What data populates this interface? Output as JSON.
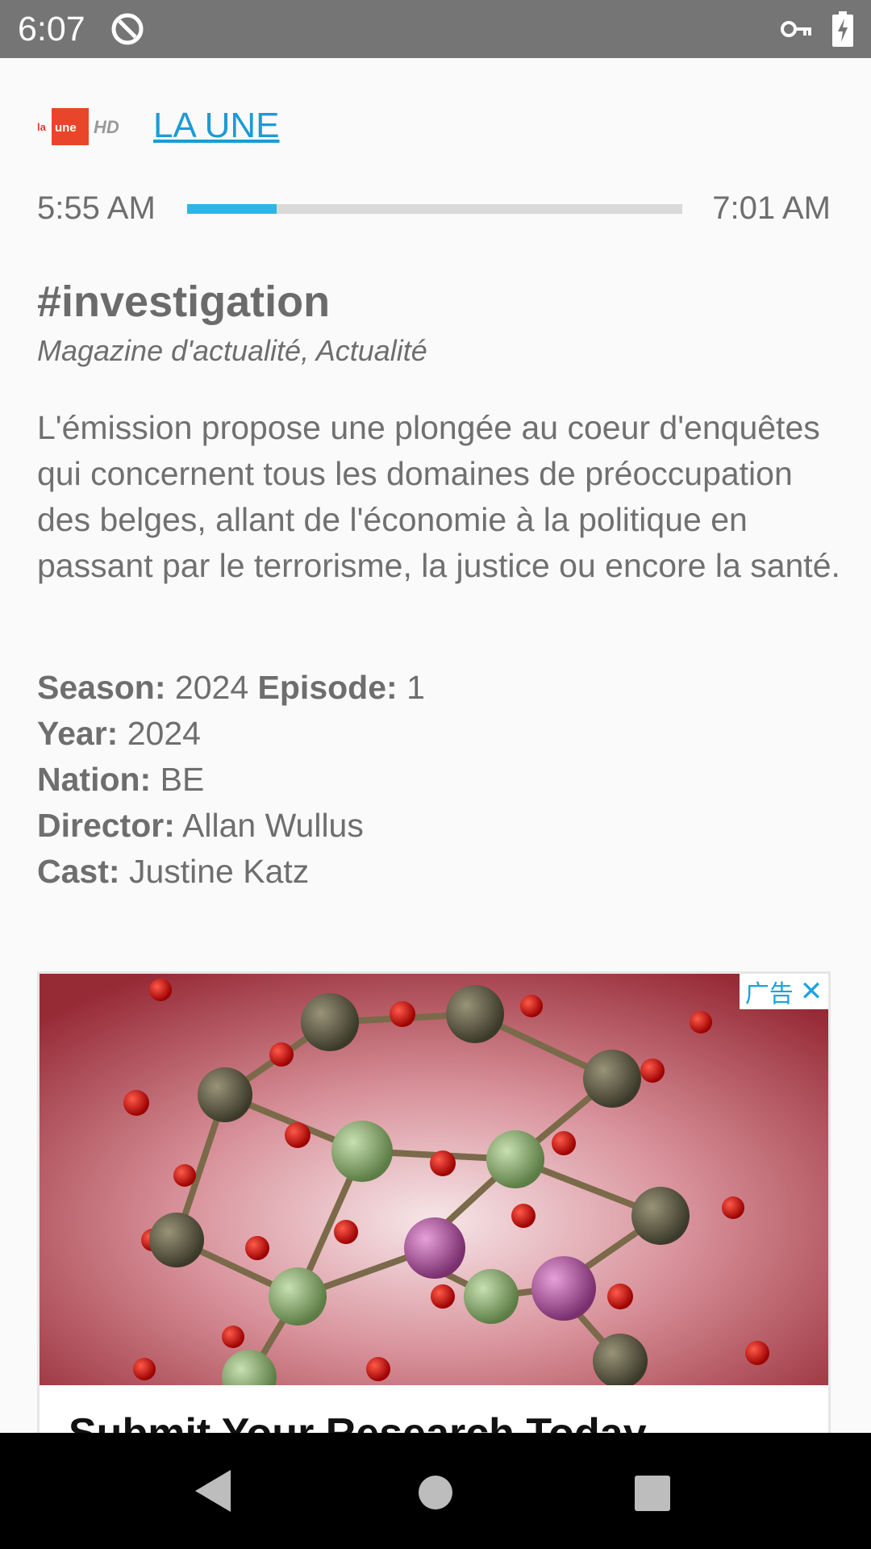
{
  "status_bar": {
    "time": "6:07",
    "icons": [
      "app-notification-icon",
      "vpn-key-icon",
      "battery-charging-icon"
    ]
  },
  "channel": {
    "logo_text": "la une HD",
    "name": "LA UNE"
  },
  "schedule": {
    "start_time": "5:55 AM",
    "end_time": "7:01 AM",
    "progress_fraction": 0.18,
    "progress_color": "#2eb5e6"
  },
  "program": {
    "title": "#investigation",
    "genre": "Magazine d'actualité, Actualité",
    "description": "L'émission propose une plongée au coeur d'enquêtes qui concernent tous les domaines de préoccupation des belges, allant de l'économie à la politique en passant par le terrorisme, la justice ou encore la santé."
  },
  "details": {
    "season_label": "Season:",
    "season_value": "2024",
    "episode_label": "Episode:",
    "episode_value": "1",
    "year_label": "Year:",
    "year_value": "2024",
    "nation_label": "Nation:",
    "nation_value": "BE",
    "director_label": "Director:",
    "director_value": "Allan Wullus",
    "cast_label": "Cast:",
    "cast_value": "Justine Katz"
  },
  "ad": {
    "badge_text": "广告",
    "close_glyph": "✕",
    "headline": "Submit Your Research Today"
  },
  "colors": {
    "accent": "#1e9ad6",
    "status_bar": "#757575",
    "nav_bar": "#000000"
  }
}
